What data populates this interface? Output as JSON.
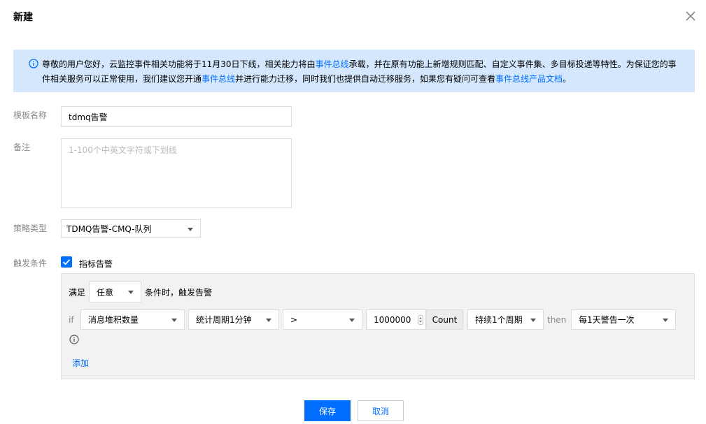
{
  "dialog": {
    "title": "新建"
  },
  "notice": {
    "part1": "尊敬的用户您好，云监控事件相关功能将于11月30日下线，相关能力将由",
    "link1": "事件总线",
    "part2": "承载，并在原有功能上新增规则匹配、自定义事件集、多目标投递等特性。为保证您的事件相关服务可以正常使用，我们建议您开通",
    "link2": "事件总线",
    "part3": "并进行能力迁移，同时我们也提供自动迁移服务，如果您有疑问可查看",
    "link3": "事件总线产品文档",
    "part4": "。"
  },
  "form": {
    "template_name_label": "模板名称",
    "template_name_value": "tdmq告警",
    "remark_label": "备注",
    "remark_placeholder": "1-100个中英文字符或下划线",
    "policy_type_label": "策略类型",
    "policy_type_value": "TDMQ告警-CMQ-队列",
    "trigger_label": "触发条件",
    "metric_alarm_label": "指标告警"
  },
  "condition": {
    "satisfy_prefix": "满足",
    "satisfy_value": "任意",
    "satisfy_suffix": "条件时，触发告警",
    "if_label": "if",
    "metric": "消息堆积数量",
    "period": "统计周期1分钟",
    "operator": ">",
    "threshold": "1000000",
    "unit": "Count",
    "duration": "持续1个周期",
    "then_label": "then",
    "frequency": "每1天警告一次",
    "add_label": "添加"
  },
  "footer": {
    "save_label": "保存",
    "cancel_label": "取消"
  },
  "colors": {
    "primary": "#006eff",
    "notice_bg": "#d5e7fd"
  }
}
